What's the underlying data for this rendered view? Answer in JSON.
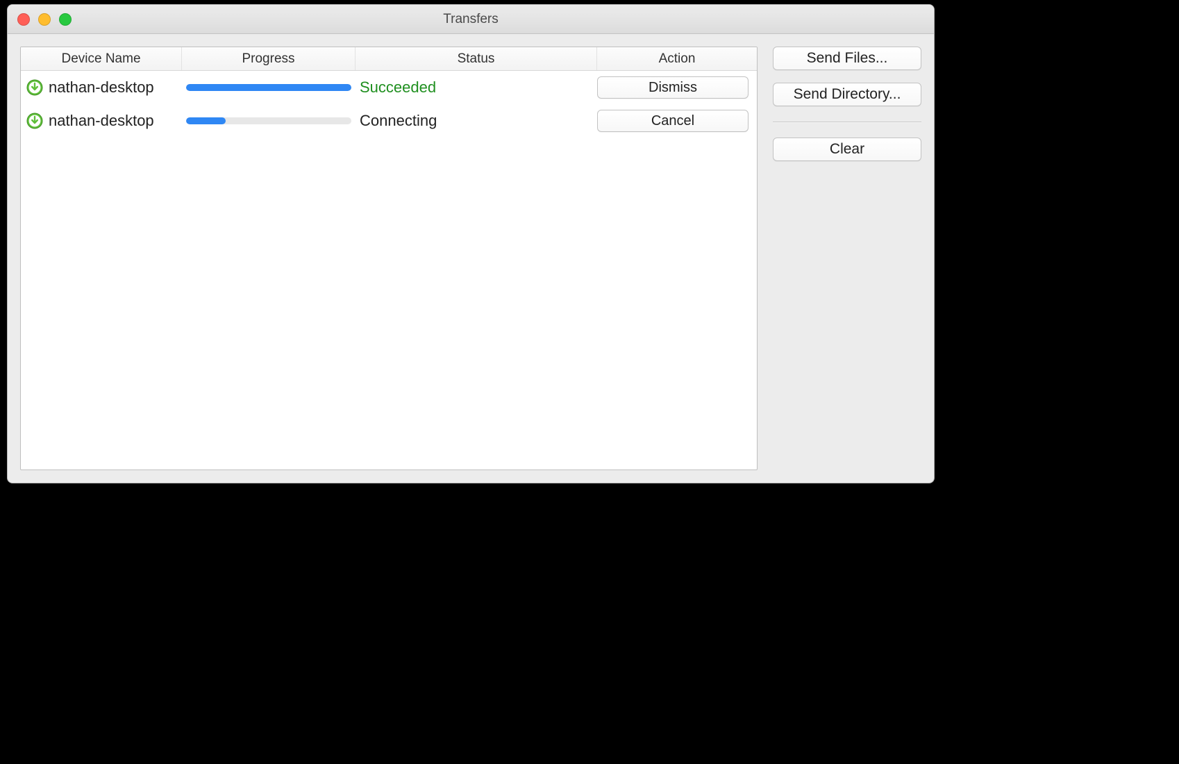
{
  "window": {
    "title": "Transfers"
  },
  "columns": {
    "device": "Device Name",
    "progress": "Progress",
    "status": "Status",
    "action": "Action"
  },
  "rows": [
    {
      "device": "nathan-desktop",
      "progress_pct": 100,
      "status": "Succeeded",
      "status_class": "status-succeeded",
      "action_label": "Dismiss",
      "action_name": "dismiss-button"
    },
    {
      "device": "nathan-desktop",
      "progress_pct": 24,
      "status": "Connecting",
      "status_class": "status-normal",
      "action_label": "Cancel",
      "action_name": "cancel-button"
    }
  ],
  "sidebar": {
    "send_files": "Send Files...",
    "send_directory": "Send Directory...",
    "clear": "Clear"
  },
  "colors": {
    "accent": "#2f87f4",
    "success": "#1f8f1f"
  }
}
